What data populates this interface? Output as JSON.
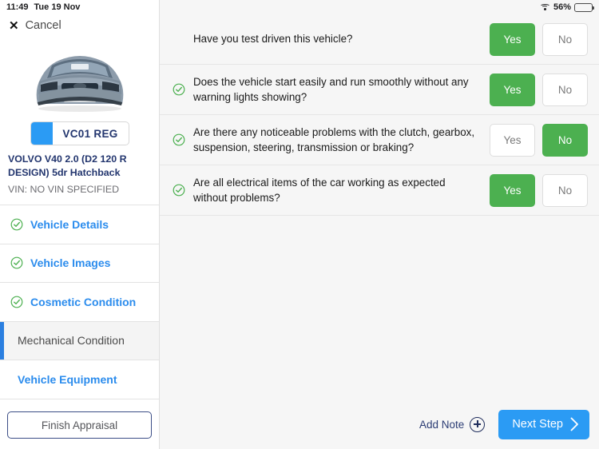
{
  "status_bar": {
    "time": "11:49",
    "date": "Tue 19 Nov",
    "wifi_icon": "wifi-icon",
    "battery_percent": "56%",
    "battery_icon": "battery-icon"
  },
  "sidebar": {
    "cancel_icon": "close-icon",
    "cancel_label": "Cancel",
    "vehicle_image_icon": "car-front-image",
    "plate": {
      "registration": "VC01 REG"
    },
    "vehicle_title": "VOLVO V40 2.0 (D2 120 R DESIGN) 5dr Hatchback",
    "vin": "VIN: NO VIN SPECIFIED",
    "items": [
      {
        "label": "Vehicle Details",
        "complete": true,
        "active": false,
        "icon": "check-circle-icon"
      },
      {
        "label": "Vehicle Images",
        "complete": true,
        "active": false,
        "icon": "check-circle-icon"
      },
      {
        "label": "Cosmetic Condition",
        "complete": true,
        "active": false,
        "icon": "check-circle-icon"
      },
      {
        "label": "Mechanical Condition",
        "complete": false,
        "active": true,
        "icon": "none"
      },
      {
        "label": "Vehicle Equipment",
        "complete": false,
        "active": false,
        "icon": "none"
      }
    ],
    "finish_label": "Finish Appraisal"
  },
  "main": {
    "questions": [
      {
        "text": "Have you test driven this vehicle?",
        "complete": false,
        "icon": "none",
        "yes_label": "Yes",
        "no_label": "No",
        "answer": "Yes"
      },
      {
        "text": "Does the vehicle start easily and run smoothly without any warning lights showing?",
        "complete": true,
        "icon": "check-circle-icon",
        "yes_label": "Yes",
        "no_label": "No",
        "answer": "Yes"
      },
      {
        "text": "Are there any noticeable problems with the clutch, gearbox, suspension, steering, transmission or braking?",
        "complete": true,
        "icon": "check-circle-icon",
        "yes_label": "Yes",
        "no_label": "No",
        "answer": "No"
      },
      {
        "text": "Are all electrical items of the car working as expected without problems?",
        "complete": true,
        "icon": "check-circle-icon",
        "yes_label": "Yes",
        "no_label": "No",
        "answer": "Yes"
      }
    ],
    "footer": {
      "add_note_label": "Add Note",
      "add_note_icon": "plus-circle-icon",
      "next_step_label": "Next Step",
      "next_step_icon": "chevron-right-icon"
    }
  },
  "colors": {
    "accent_blue": "#2b9bf4",
    "selected_green": "#4cb050",
    "navy_text": "#22356e",
    "active_nav_bar": "#2b7fe0"
  }
}
